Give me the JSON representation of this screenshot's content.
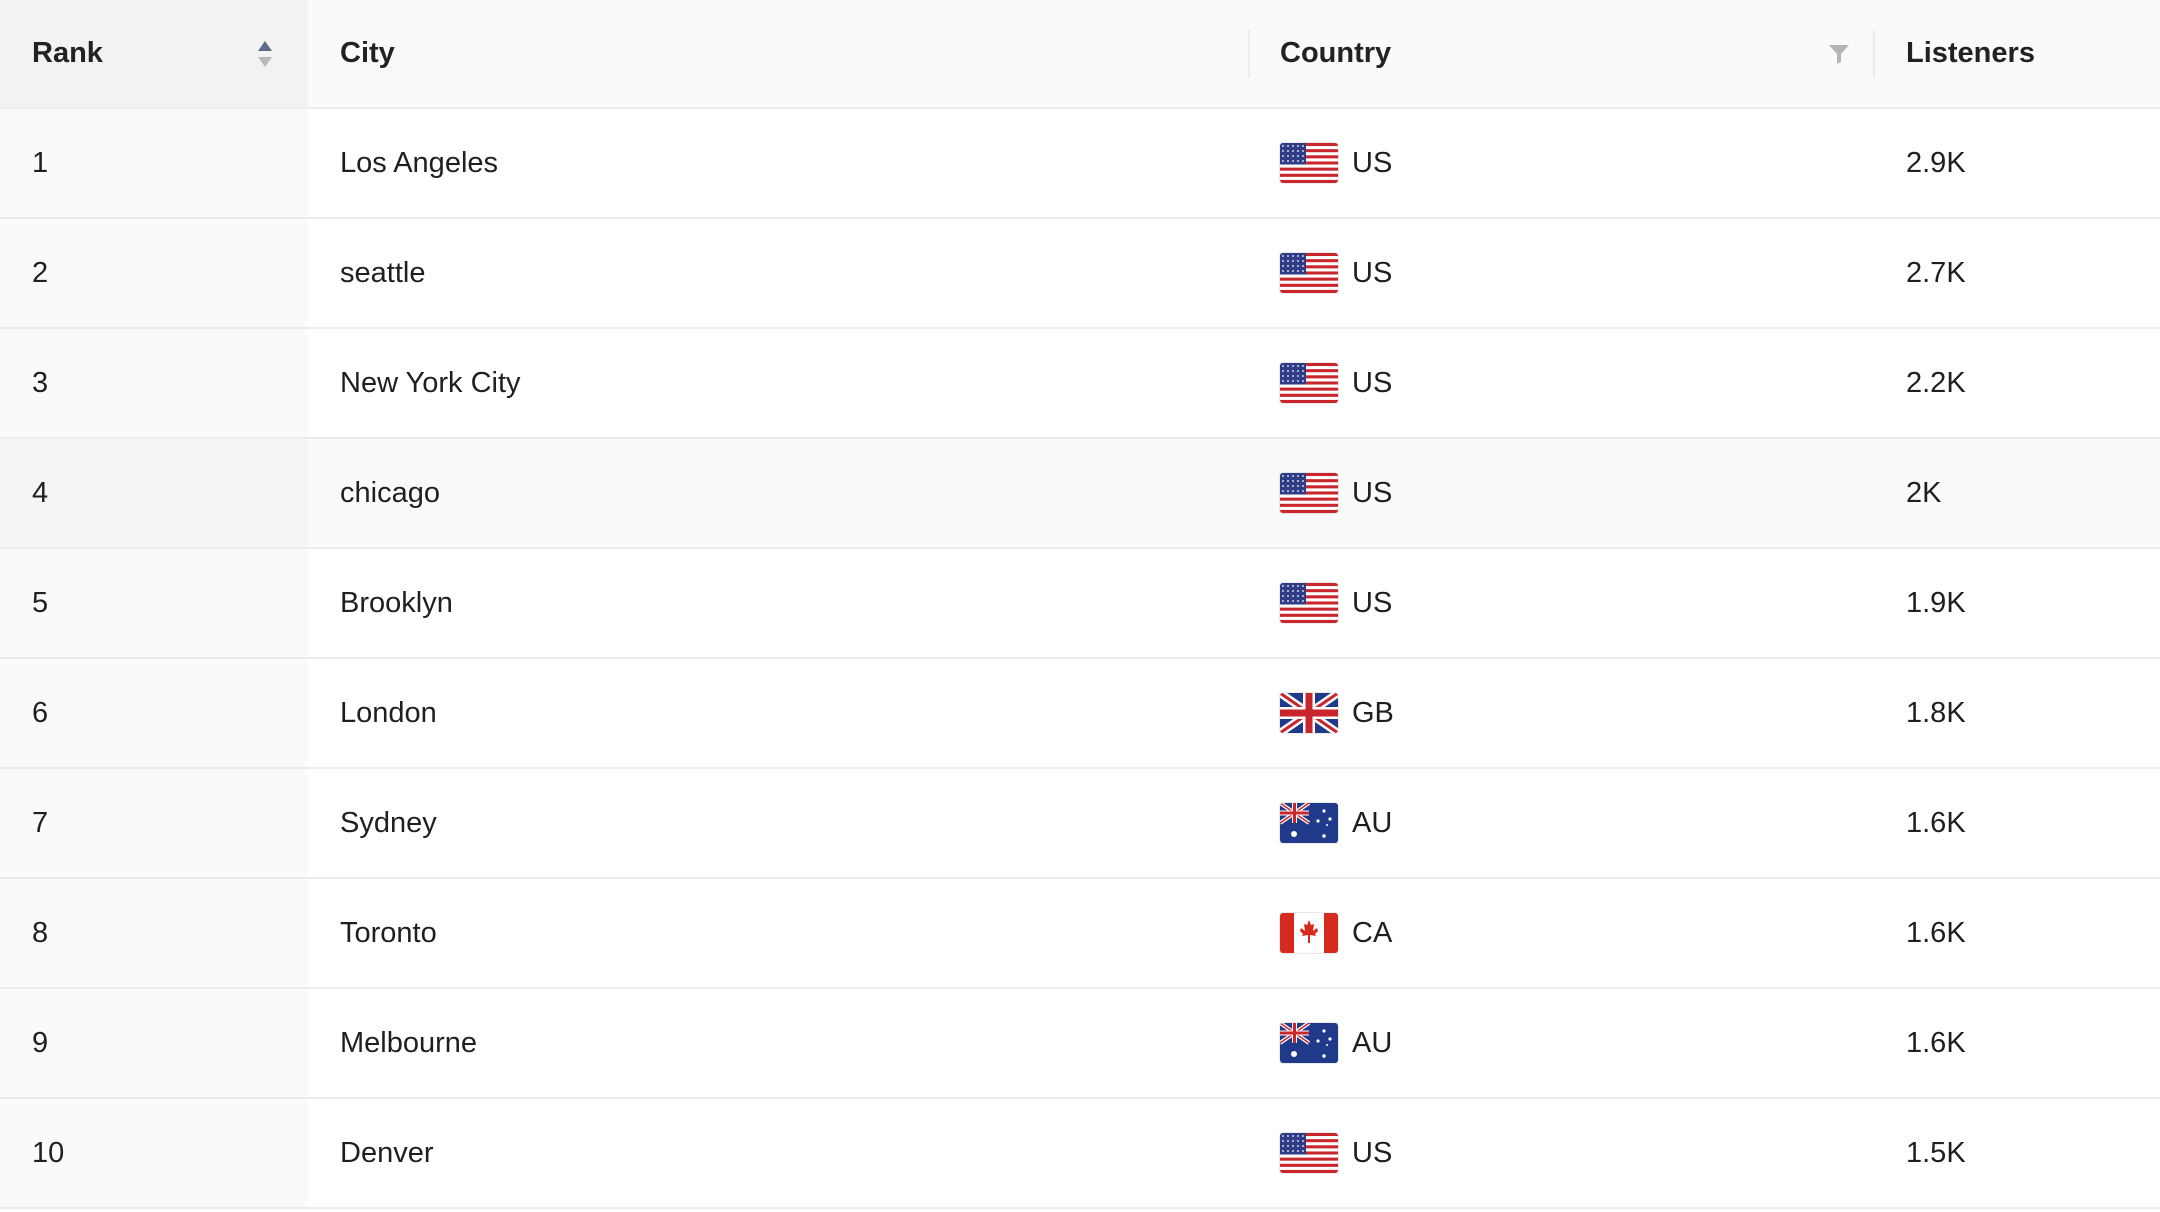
{
  "header": {
    "rank": "Rank",
    "city": "City",
    "country": "Country",
    "listeners": "Listeners"
  },
  "rows": [
    {
      "rank": "1",
      "city": "Los Angeles",
      "country": "US",
      "flag": "us-flag-icon",
      "listeners": "2.9K"
    },
    {
      "rank": "2",
      "city": "seattle",
      "country": "US",
      "flag": "us-flag-icon",
      "listeners": "2.7K"
    },
    {
      "rank": "3",
      "city": "New York City",
      "country": "US",
      "flag": "us-flag-icon",
      "listeners": "2.2K"
    },
    {
      "rank": "4",
      "city": "chicago",
      "country": "US",
      "flag": "us-flag-icon",
      "listeners": "2K"
    },
    {
      "rank": "5",
      "city": "Brooklyn",
      "country": "US",
      "flag": "us-flag-icon",
      "listeners": "1.9K"
    },
    {
      "rank": "6",
      "city": "London",
      "country": "GB",
      "flag": "gb-flag-icon",
      "listeners": "1.8K"
    },
    {
      "rank": "7",
      "city": "Sydney",
      "country": "AU",
      "flag": "au-flag-icon",
      "listeners": "1.6K"
    },
    {
      "rank": "8",
      "city": "Toronto",
      "country": "CA",
      "flag": "ca-flag-icon",
      "listeners": "1.6K"
    },
    {
      "rank": "9",
      "city": "Melbourne",
      "country": "AU",
      "flag": "au-flag-icon",
      "listeners": "1.6K"
    },
    {
      "rank": "10",
      "city": "Denver",
      "country": "US",
      "flag": "us-flag-icon",
      "listeners": "1.5K"
    }
  ],
  "colors": {
    "sort_up": "#5b6b8c",
    "sort_down": "#b8b8b8",
    "filter": "#b5b5b5"
  }
}
